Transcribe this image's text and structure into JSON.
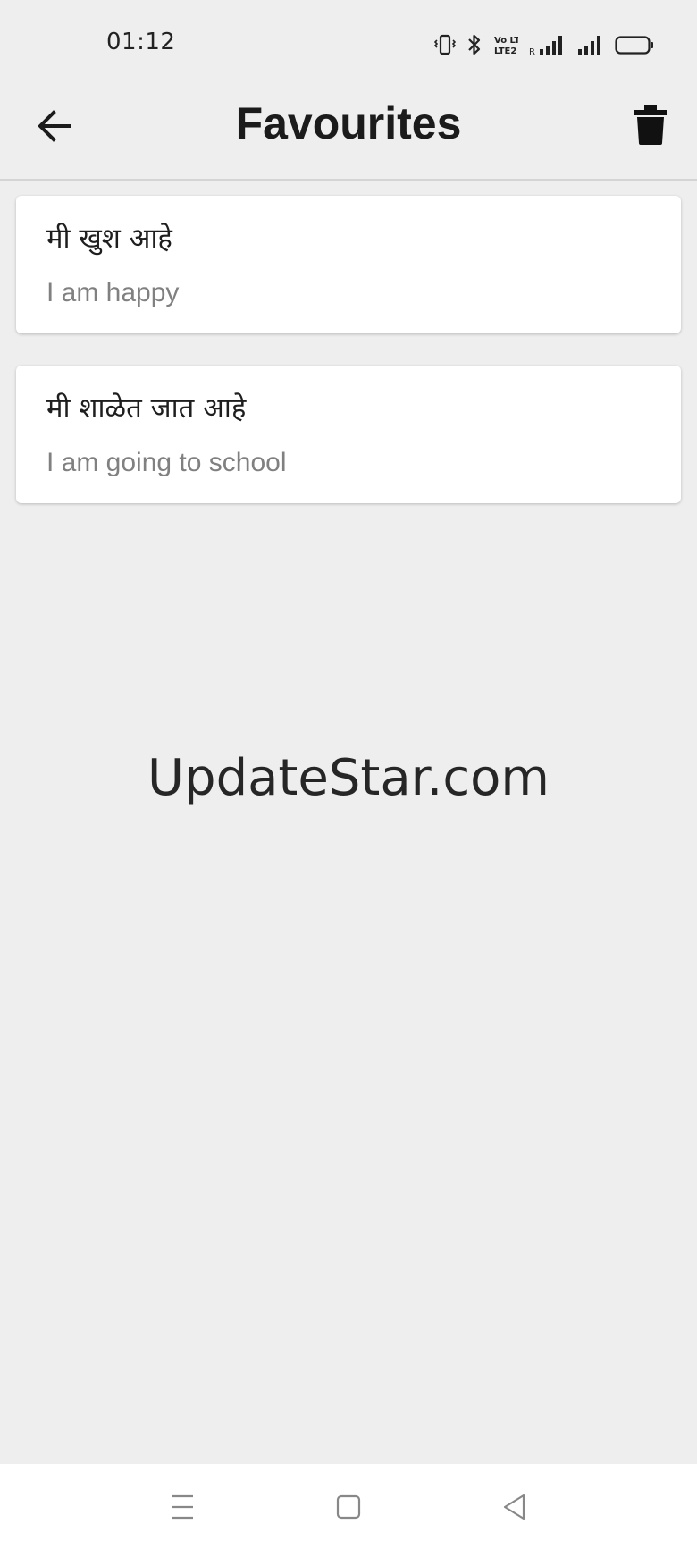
{
  "status_bar": {
    "time": "01:12",
    "icons": [
      "vibrate-icon",
      "bluetooth-icon",
      "volte-icon",
      "signal-roaming-icon",
      "signal-icon",
      "battery-icon"
    ],
    "volte_text": "Vo LTE2",
    "roaming_text": "R"
  },
  "app_bar": {
    "title": "Favourites",
    "back_icon": "arrow-back-icon",
    "delete_icon": "trash-icon"
  },
  "favourites": [
    {
      "marathi": "मी खुश आहे",
      "english": "I am happy"
    },
    {
      "marathi": "मी शाळेत जात आहे",
      "english": "I am going to school"
    }
  ],
  "watermark": "UpdateStar.com",
  "nav_bar": {
    "icons": [
      "menu-icon",
      "home-square-icon",
      "back-triangle-icon"
    ]
  },
  "colors": {
    "background": "#eeeeee",
    "card": "#ffffff",
    "primary_text": "#1e1e1e",
    "secondary_text": "#808080"
  }
}
